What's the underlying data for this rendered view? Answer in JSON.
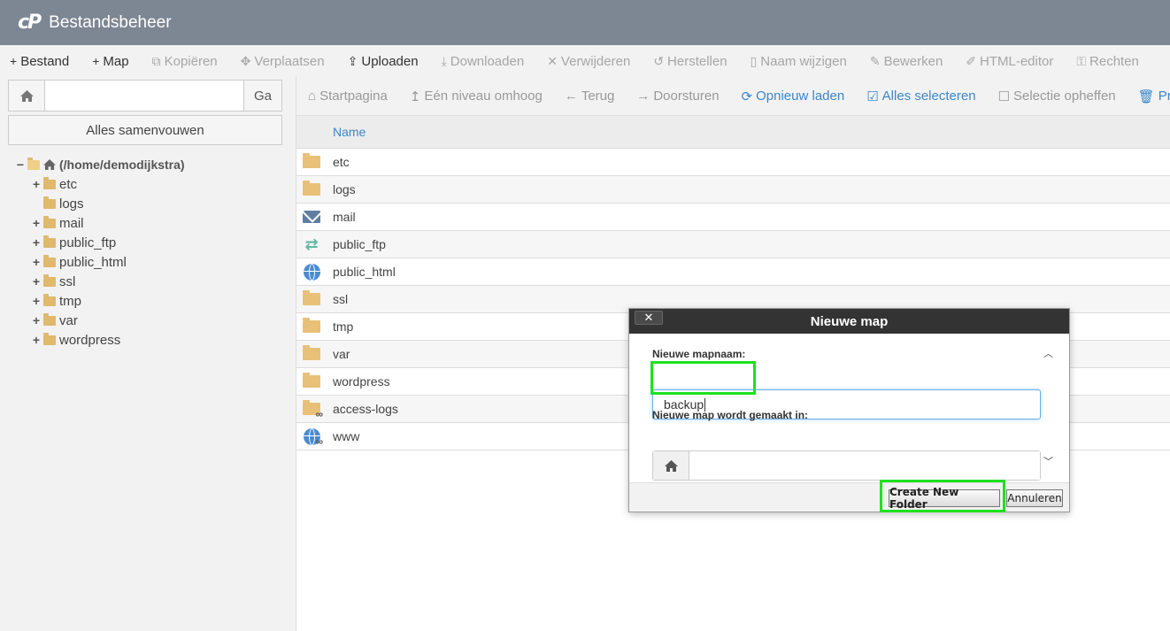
{
  "header": {
    "logo": "cP",
    "title": "Bestandsbeheer"
  },
  "toolbar": {
    "items": [
      {
        "label": "Bestand",
        "icon": "+",
        "enabled": true
      },
      {
        "label": "Map",
        "icon": "+",
        "enabled": true
      },
      {
        "label": "Kopiëren",
        "icon": "⧉",
        "enabled": false
      },
      {
        "label": "Verplaatsen",
        "icon": "✥",
        "enabled": false
      },
      {
        "label": "Uploaden",
        "icon": "⇪",
        "enabled": true
      },
      {
        "label": "Downloaden",
        "icon": "⤓",
        "enabled": false
      },
      {
        "label": "Verwijderen",
        "icon": "✕",
        "enabled": false
      },
      {
        "label": "Herstellen",
        "icon": "↺",
        "enabled": false
      },
      {
        "label": "Naam wijzigen",
        "icon": "▯",
        "enabled": false
      },
      {
        "label": "Bewerken",
        "icon": "✎",
        "enabled": false
      },
      {
        "label": "HTML-editor",
        "icon": "✐",
        "enabled": false
      },
      {
        "label": "Rechten",
        "icon": "⚿",
        "enabled": false
      }
    ]
  },
  "left": {
    "go_label": "Ga",
    "collapse_label": "Alles samenvouwen",
    "root_label": "(/home/demodijkstra)",
    "tree": [
      {
        "label": "etc",
        "expandable": true
      },
      {
        "label": "logs",
        "expandable": false
      },
      {
        "label": "mail",
        "expandable": true
      },
      {
        "label": "public_ftp",
        "expandable": true
      },
      {
        "label": "public_html",
        "expandable": true
      },
      {
        "label": "ssl",
        "expandable": true
      },
      {
        "label": "tmp",
        "expandable": true
      },
      {
        "label": "var",
        "expandable": true
      },
      {
        "label": "wordpress",
        "expandable": true
      }
    ]
  },
  "right": {
    "toolbar": [
      {
        "label": "Startpagina",
        "icon": "⌂",
        "active": false
      },
      {
        "label": "Eén niveau omhoog",
        "icon": "↥",
        "active": false
      },
      {
        "label": "Terug",
        "icon": "←",
        "active": false
      },
      {
        "label": "Doorsturen",
        "icon": "→",
        "active": false
      },
      {
        "label": "Opnieuw laden",
        "icon": "⟳",
        "active": true
      },
      {
        "label": "Alles selecteren",
        "icon": "☑",
        "active": true
      },
      {
        "label": "Selectie opheffen",
        "icon": "☐",
        "active": false
      },
      {
        "label": "Prull",
        "icon": "🗑",
        "active": true
      }
    ],
    "column_name": "Name",
    "files": [
      {
        "name": "etc",
        "icon": "folder-icon"
      },
      {
        "name": "logs",
        "icon": "folder-icon"
      },
      {
        "name": "mail",
        "icon": "mail-icon"
      },
      {
        "name": "public_ftp",
        "icon": "ftp-icon"
      },
      {
        "name": "public_html",
        "icon": "globe-icon"
      },
      {
        "name": "ssl",
        "icon": "folder-icon"
      },
      {
        "name": "tmp",
        "icon": "folder-icon"
      },
      {
        "name": "var",
        "icon": "folder-icon"
      },
      {
        "name": "wordpress",
        "icon": "folder-icon"
      },
      {
        "name": "access-logs",
        "icon": "folder-link-icon"
      },
      {
        "name": "www",
        "icon": "globe-link-icon"
      }
    ]
  },
  "dialog": {
    "title": "Nieuwe map",
    "close": "✕",
    "name_label": "Nieuwe mapnaam:",
    "name_value": "backup",
    "path_label": "Nieuwe map wordt gemaakt in:",
    "path_value": "",
    "create_label": "Create New Folder",
    "cancel_label": "Annuleren"
  },
  "colors": {
    "header": "#7d8793",
    "accent": "#3a87c9",
    "highlight": "#1fe01f",
    "dialog_title": "#333333"
  }
}
